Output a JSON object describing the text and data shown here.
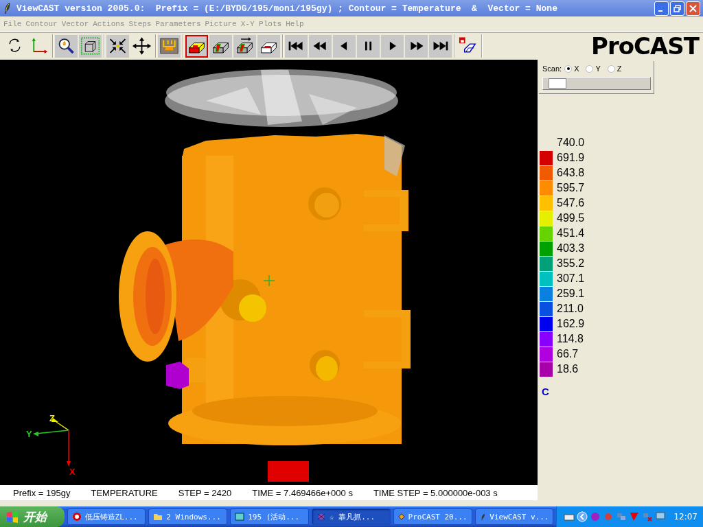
{
  "window": {
    "title": "ViewCAST version 2005.0:  Prefix = (E:/BYDG/195/moni/195gy) ; Contour = Temperature  &  Vector = None"
  },
  "menu": [
    {
      "label": "File",
      "disabled": true
    },
    {
      "label": "Contour",
      "disabled": true
    },
    {
      "label": "Vector",
      "disabled": true
    },
    {
      "label": "Actions",
      "disabled": true
    },
    {
      "label": "Steps",
      "disabled": true
    },
    {
      "label": "Parameters",
      "disabled": true
    },
    {
      "label": "Picture",
      "disabled": true
    },
    {
      "label": "X-Y Plots",
      "disabled": true
    },
    {
      "label": "Help",
      "disabled": true
    }
  ],
  "toolbar": {
    "groups": [
      [
        {
          "kind": "rotate",
          "selected": false
        },
        {
          "kind": "axes",
          "selected": false
        }
      ],
      [
        {
          "kind": "zoom",
          "selected": false
        },
        {
          "kind": "box",
          "selected": false
        }
      ],
      [
        {
          "kind": "shrink",
          "selected": false
        },
        {
          "kind": "move",
          "selected": false
        }
      ],
      [
        {
          "kind": "mold",
          "selected": false
        }
      ],
      [
        {
          "kind": "contour",
          "selected": true
        },
        {
          "kind": "cut",
          "selected": false
        },
        {
          "kind": "vector",
          "selected": false
        },
        {
          "kind": "section",
          "selected": false
        }
      ],
      [
        {
          "kind": "first",
          "selected": false
        },
        {
          "kind": "rewind",
          "selected": false
        },
        {
          "kind": "back",
          "selected": false
        },
        {
          "kind": "pause",
          "selected": false
        },
        {
          "kind": "play",
          "selected": false
        },
        {
          "kind": "forward",
          "selected": false
        },
        {
          "kind": "last",
          "selected": false
        }
      ],
      [
        {
          "kind": "print",
          "selected": false
        }
      ]
    ],
    "logo": "ProCAST"
  },
  "axis_triad": {
    "labels": [
      "Z",
      "Y",
      "X"
    ]
  },
  "scan": {
    "label": "Scan:",
    "options": [
      {
        "label": "X",
        "selected": true
      },
      {
        "label": "Y",
        "selected": false
      },
      {
        "label": "Z",
        "selected": false
      }
    ],
    "level": 0.05
  },
  "legend": {
    "entries": [
      {
        "value": "740.0"
      },
      {
        "value": "691.9",
        "color": "#d40000"
      },
      {
        "value": "643.8",
        "color": "#f05a00"
      },
      {
        "value": "595.7",
        "color": "#ff8c00"
      },
      {
        "value": "547.6",
        "color": "#ffc000"
      },
      {
        "value": "499.5",
        "color": "#e4f000"
      },
      {
        "value": "451.4",
        "color": "#66d400"
      },
      {
        "value": "403.3",
        "color": "#00a000"
      },
      {
        "value": "355.2",
        "color": "#00a078"
      },
      {
        "value": "307.1",
        "color": "#00c0c0"
      },
      {
        "value": "259.1",
        "color": "#0a80e0"
      },
      {
        "value": "211.0",
        "color": "#0a50e0"
      },
      {
        "value": "162.9",
        "color": "#0000f0"
      },
      {
        "value": "114.8",
        "color": "#8a00ff"
      },
      {
        "value": "66.7",
        "color": "#b000e0"
      },
      {
        "value": "18.6",
        "color": "#a800a8"
      }
    ],
    "unit": "C"
  },
  "status": [
    "Prefix = 195gy",
    "TEMPERATURE",
    "STEP = 2420",
    "TIME = 7.469466e+000 s",
    "TIME STEP = 5.000000e-003 s"
  ],
  "taskbar": {
    "start": "开始",
    "tasks": [
      {
        "kind": "browser",
        "label": "低压铸造ZL...",
        "selected": false
      },
      {
        "kind": "folder",
        "label": "2 Windows...",
        "selected": false
      },
      {
        "kind": "app",
        "label": "195 (活动...",
        "selected": false
      },
      {
        "kind": "bug",
        "label": "☆ 靠凡抓...",
        "selected": true
      },
      {
        "kind": "diamond",
        "label": "ProCAST 20...",
        "selected": false
      },
      {
        "kind": "feather",
        "label": "ViewCAST v...",
        "selected": false
      }
    ],
    "clock": "12:07"
  }
}
